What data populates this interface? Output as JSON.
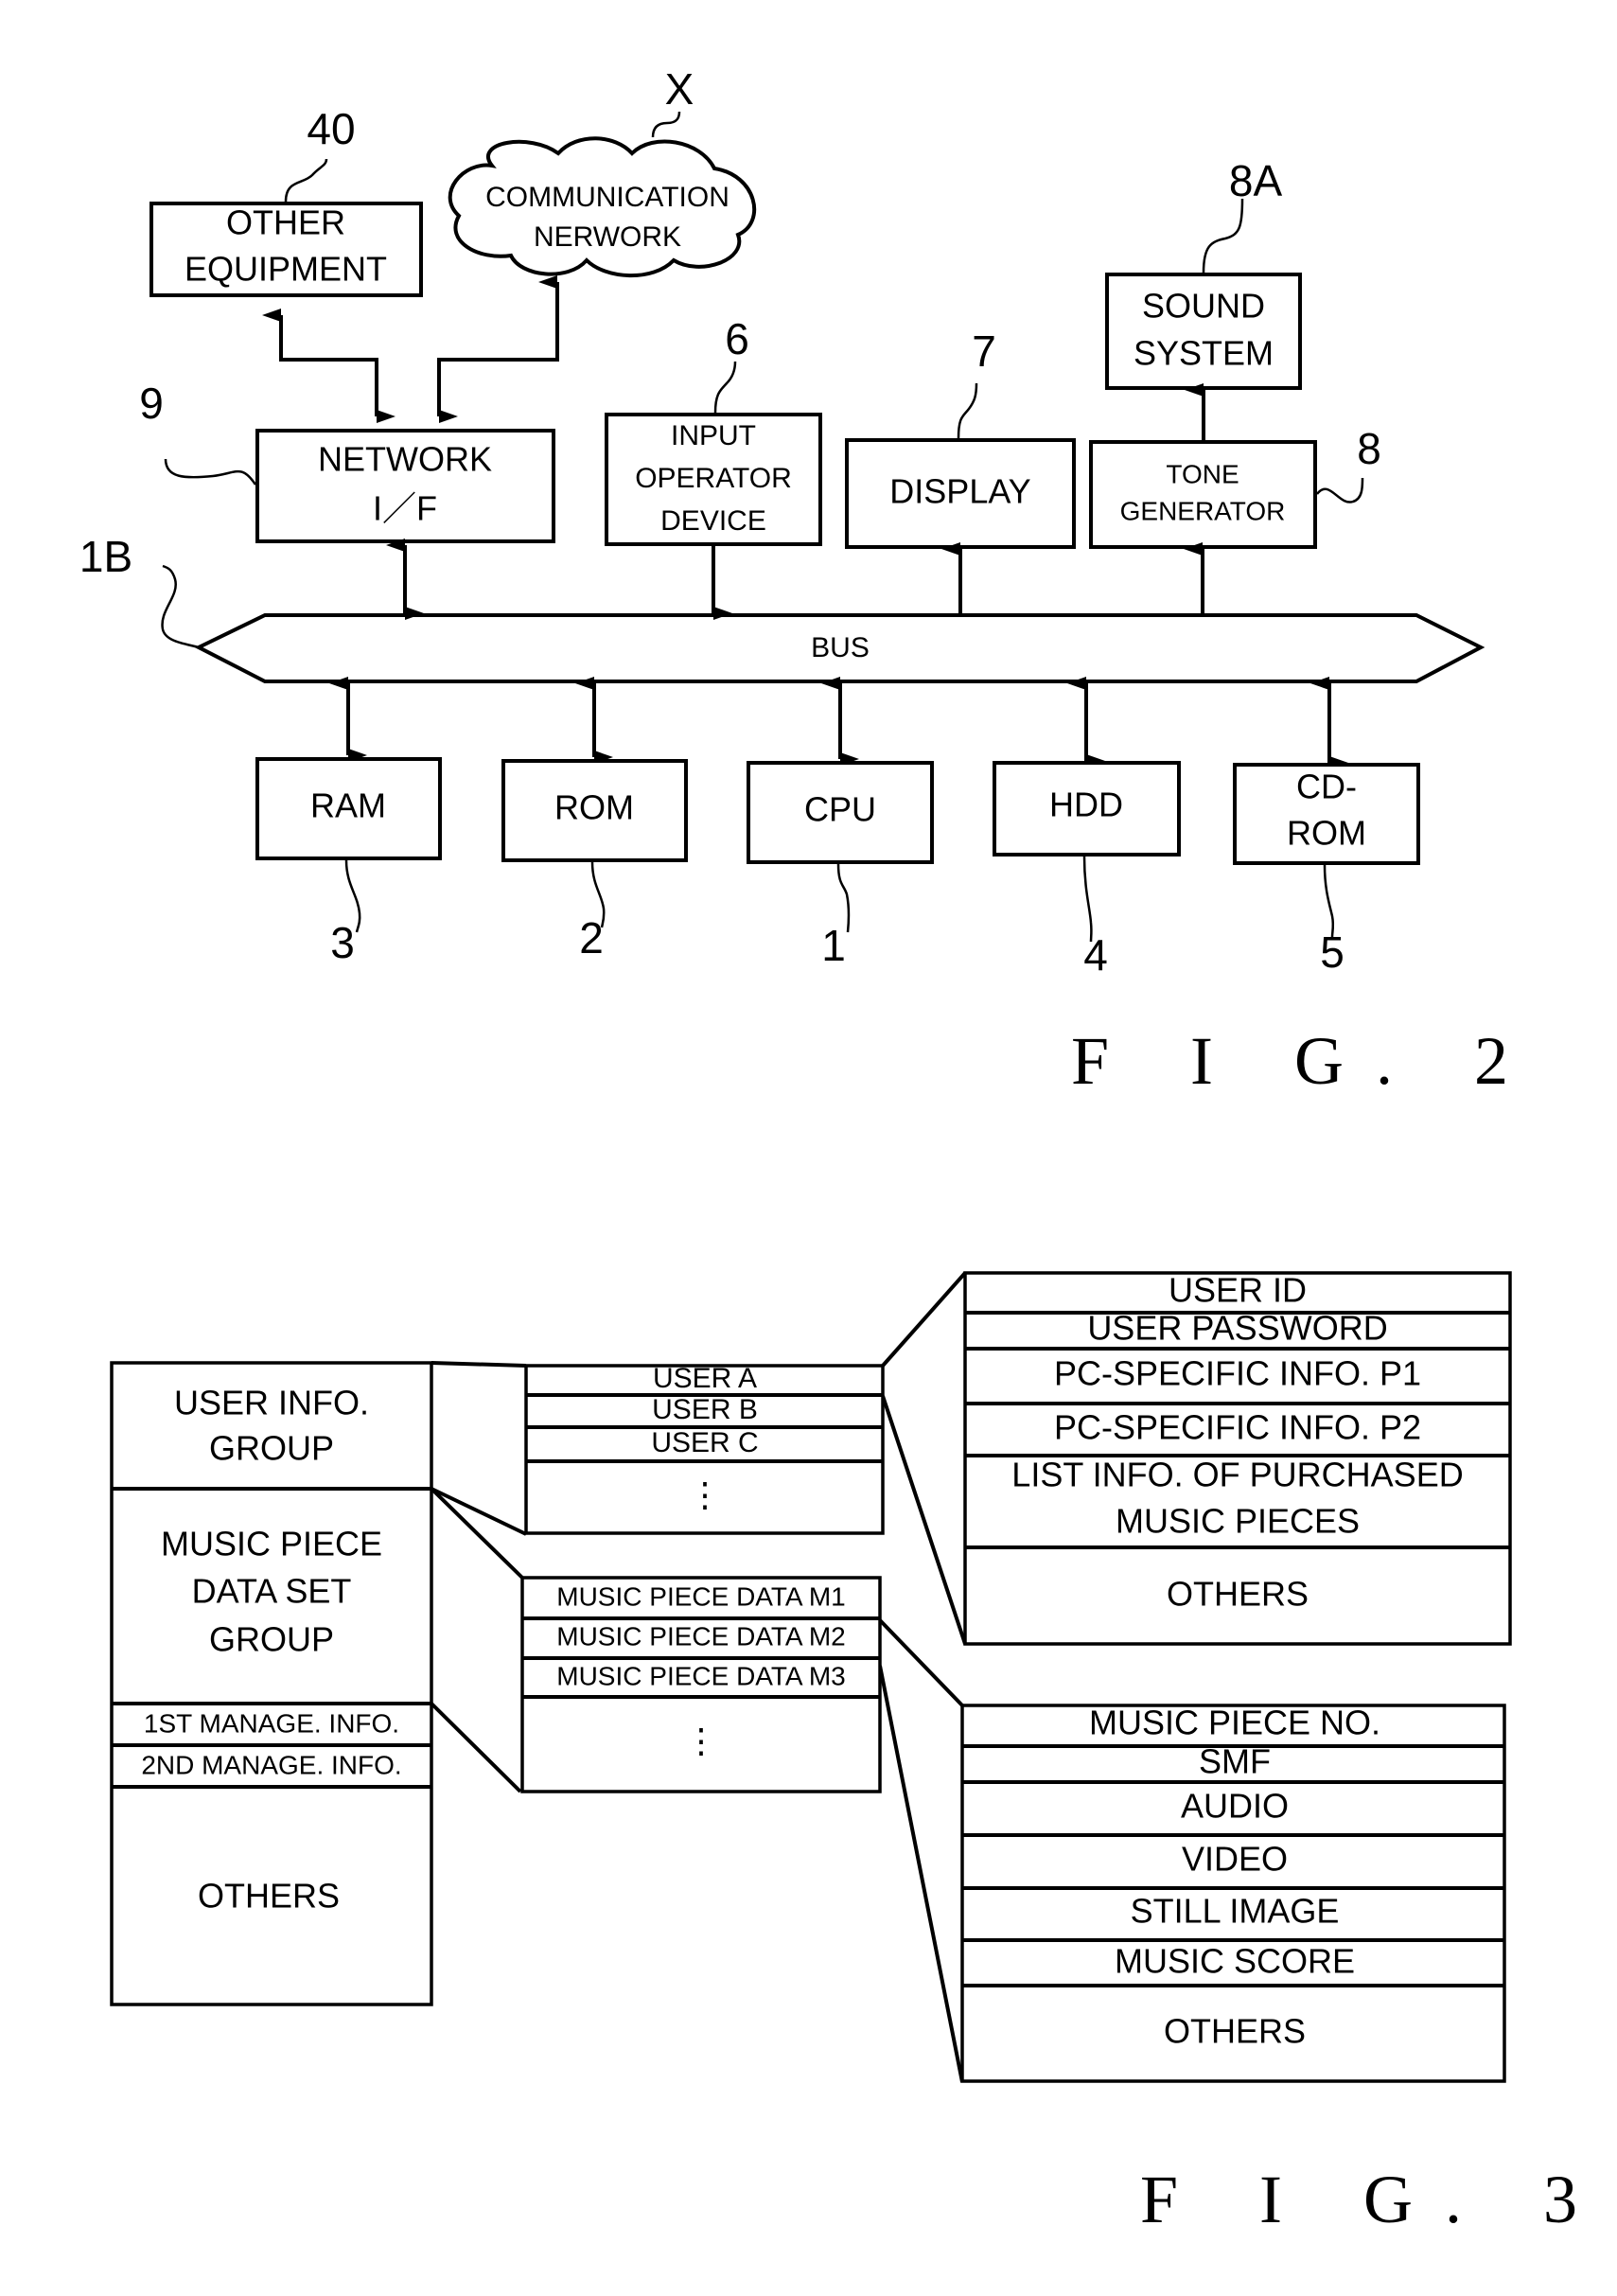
{
  "fig2": {
    "caption": "F I G. 2",
    "blocks": {
      "other_equipment": {
        "lines": [
          "OTHER",
          "EQUIPMENT"
        ],
        "ref": "40"
      },
      "communication_network": {
        "lines": [
          "COMMUNICATION",
          "NERWORK"
        ],
        "ref": "X"
      },
      "network_if": {
        "lines": [
          "NETWORK",
          "I／F"
        ],
        "ref": "9"
      },
      "input_operator_device": {
        "lines": [
          "INPUT",
          "OPERATOR",
          "DEVICE"
        ],
        "ref": "6"
      },
      "display": {
        "lines": [
          "DISPLAY"
        ],
        "ref": "7"
      },
      "tone_generator": {
        "lines": [
          "TONE",
          "GENERATOR"
        ],
        "ref": "8"
      },
      "sound_system": {
        "lines": [
          "SOUND",
          "SYSTEM"
        ],
        "ref": "8A"
      },
      "bus": {
        "label": "BUS",
        "ref": "1B"
      },
      "ram": {
        "lines": [
          "RAM"
        ],
        "ref": "3"
      },
      "rom": {
        "lines": [
          "ROM"
        ],
        "ref": "2"
      },
      "cpu": {
        "lines": [
          "CPU"
        ],
        "ref": "1"
      },
      "hdd": {
        "lines": [
          "HDD"
        ],
        "ref": "4"
      },
      "cdrom": {
        "lines": [
          "CD-",
          "ROM"
        ],
        "ref": "5"
      }
    }
  },
  "fig3": {
    "caption": "F I G. 3",
    "main_table": {
      "user_info_group": [
        "USER INFO.",
        "GROUP"
      ],
      "music_piece_data_set_group": [
        "MUSIC PIECE",
        "DATA SET",
        "GROUP"
      ],
      "first_manage_info": "1ST MANAGE. INFO.",
      "second_manage_info": "2ND MANAGE. INFO.",
      "others": "OTHERS"
    },
    "user_list": [
      "USER A",
      "USER B",
      "USER C",
      "⋮"
    ],
    "music_list": [
      "MUSIC PIECE DATA M1",
      "MUSIC PIECE DATA M2",
      "MUSIC PIECE DATA M3",
      "⋮"
    ],
    "user_detail": {
      "user_id": "USER ID",
      "user_password": "USER PASSWORD",
      "pc_info_p1": "PC-SPECIFIC INFO. P1",
      "pc_info_p2": "PC-SPECIFIC INFO. P2",
      "purchased_list": [
        "LIST INFO. OF PURCHASED",
        "MUSIC PIECES"
      ],
      "others": "OTHERS"
    },
    "music_detail": [
      "MUSIC PIECE NO.",
      "SMF",
      "AUDIO",
      "VIDEO",
      "STILL IMAGE",
      "MUSIC SCORE",
      "OTHERS"
    ]
  }
}
